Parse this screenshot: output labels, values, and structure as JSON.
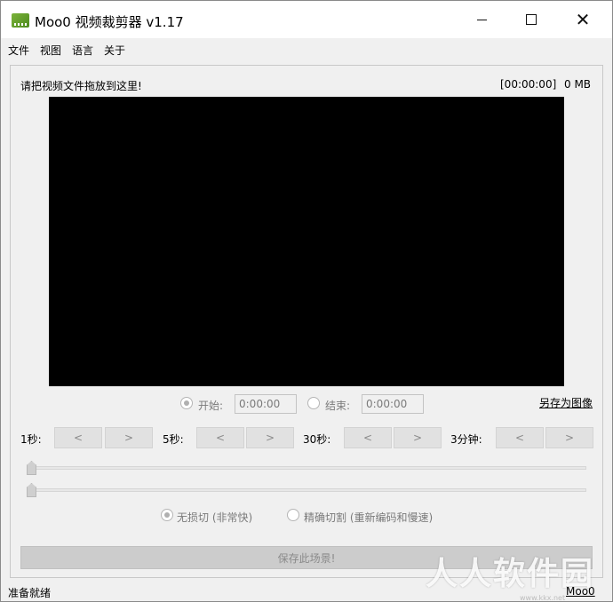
{
  "window": {
    "title": "Moo0 视频裁剪器 v1.17",
    "minimize_icon": "minimize-icon",
    "maximize_icon": "maximize-icon",
    "close_icon": "close-icon",
    "close_glyph": "✕"
  },
  "menu": {
    "items": [
      "文件",
      "视图",
      "语言",
      "关于"
    ]
  },
  "main": {
    "drop_hint": "请把视频文件拖放到这里!",
    "time_readout": "[00:00:00]",
    "size_readout": "0 MB"
  },
  "range": {
    "start_label": "开始:",
    "start_value": "0:00:00",
    "end_label": "结束:",
    "end_value": "0:00:00",
    "save_image_link": "另存为图像"
  },
  "steps": [
    {
      "label": "1秒:",
      "prev": "<",
      "next": ">"
    },
    {
      "label": "5秒:",
      "prev": "<",
      "next": ">"
    },
    {
      "label": "30秒:",
      "prev": "<",
      "next": ">"
    },
    {
      "label": "3分钟:",
      "prev": "<",
      "next": ">"
    }
  ],
  "cut_mode": {
    "lossless_label": "无损切 (非常快)",
    "precise_label": "精确切割 (重新编码和慢速)",
    "selected": "lossless"
  },
  "save_button": "保存此场景!",
  "status": {
    "left": "准备就绪",
    "right": "Moo0"
  },
  "watermark": {
    "text": "人人软件园",
    "sub": "www.kkx.net"
  },
  "colors": {
    "video_background": "#000000",
    "window_background": "#f0f0f0"
  }
}
